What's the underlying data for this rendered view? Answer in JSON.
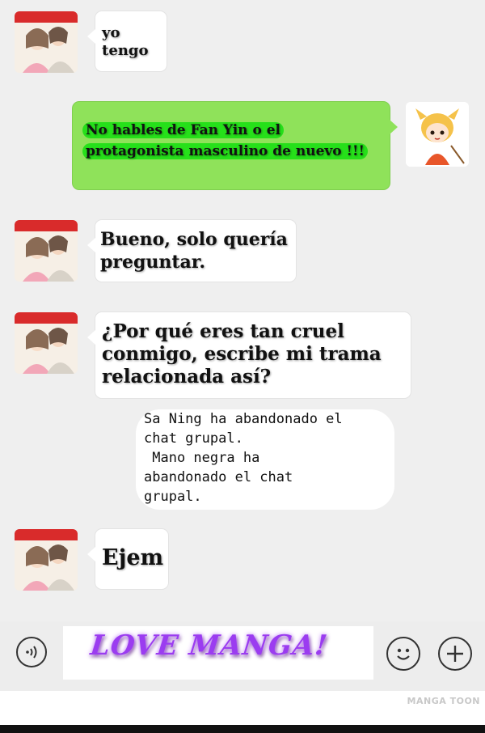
{
  "messages": [
    {
      "side": "left",
      "text": "yo tengo"
    },
    {
      "side": "right",
      "text": "No hables de Fan Yin o el protagonista masculino de nuevo !!!"
    },
    {
      "side": "left",
      "text": "Bueno, solo quería preguntar."
    },
    {
      "side": "left",
      "text": "¿Por qué eres tan cruel conmigo, escribe mi trama relacionada así?"
    },
    {
      "side": "left",
      "text": "Ejem"
    }
  ],
  "system_notice": "Sa Ning ha abandonado el\nchat grupal.\n Mano negra ha\nabandonado el chat\ngrupal.",
  "input_bar": {
    "text": "LOVE MANGA!",
    "voice_icon": "voice-icon",
    "emoji_icon": "emoji-icon",
    "plus_icon": "plus-icon"
  },
  "watermark": "MANGA TOON",
  "colors": {
    "background": "#efefef",
    "right_bubble": "#8fe25a",
    "highlight": "#26e01a",
    "input_text": "#9b3cf0"
  }
}
